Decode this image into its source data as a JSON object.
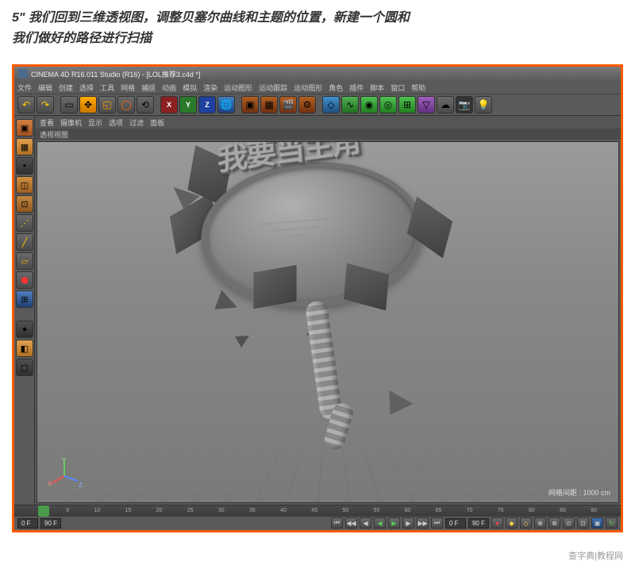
{
  "instruction": {
    "line1": "5\" 我们回到三维透视图，调整贝塞尔曲线和主题的位置，新建一个圆和",
    "line2": "我们做好的路径进行扫描"
  },
  "titlebar": {
    "text": "CINEMA 4D R16.011 Studio (R16) - [LOL推荐3.c4d *]"
  },
  "menubar": {
    "items": [
      "文件",
      "编辑",
      "创建",
      "选择",
      "工具",
      "网格",
      "捕捉",
      "动画",
      "模拟",
      "渲染",
      "运动图形",
      "运动跟踪",
      "运动图形",
      "角色",
      "插件",
      "脚本",
      "窗口",
      "帮助"
    ]
  },
  "toolbar": {
    "axis_x": "X",
    "axis_y": "Y",
    "axis_z": "Z"
  },
  "viewport_menu": {
    "items": [
      "查看",
      "摄像机",
      "显示",
      "选项",
      "过滤",
      "面板"
    ]
  },
  "viewport_tab": "透视视图",
  "badge": {
    "main_text": "我要当主角",
    "sub_line1": "═══════════════",
    "sub_line2": "═══════════",
    "sub_line3": "═════"
  },
  "axis_labels": {
    "x": "X",
    "y": "Y",
    "z": "Z"
  },
  "grid_info": "网格间距 : 1000 cm",
  "timeline": {
    "ticks": [
      "0",
      "5",
      "10",
      "15",
      "20",
      "25",
      "30",
      "35",
      "40",
      "45",
      "50",
      "55",
      "60",
      "65",
      "70",
      "75",
      "80",
      "85",
      "90"
    ],
    "frame_start": "0 F",
    "frame_end": "90 F",
    "frame_cur": "0 F",
    "frame_total": "90 F"
  },
  "watermark": "查字典|教程网"
}
